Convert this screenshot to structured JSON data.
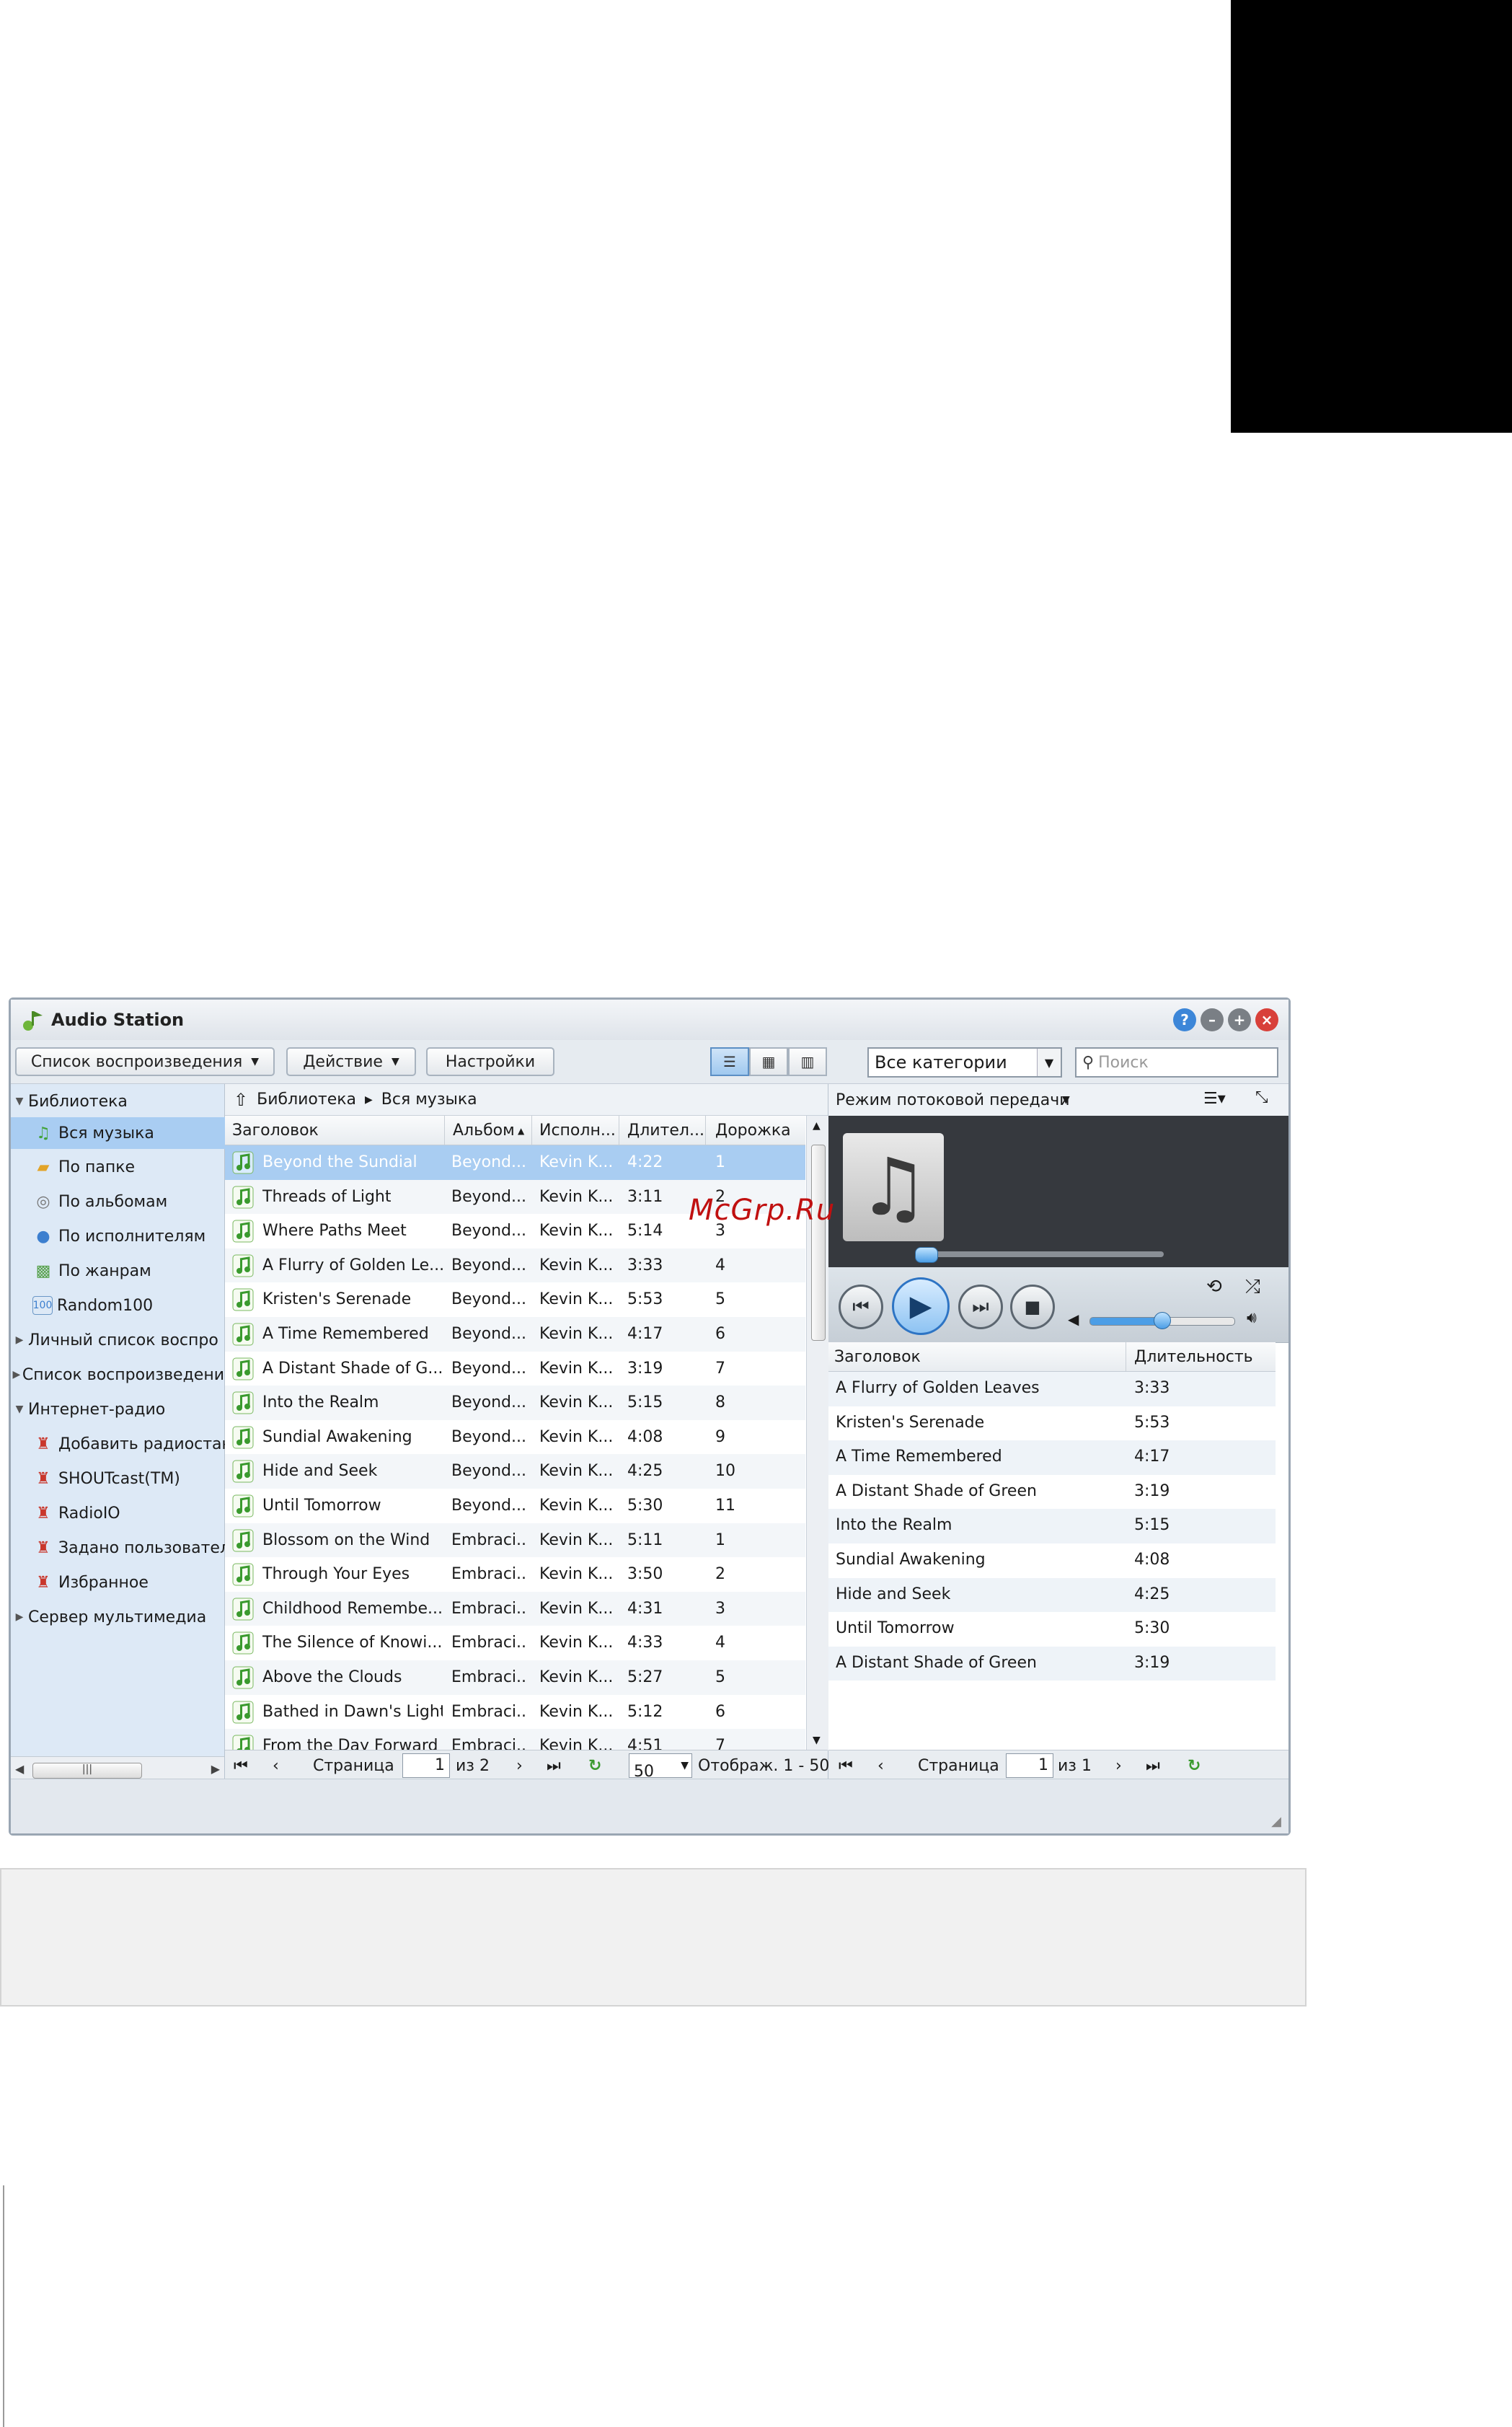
{
  "watermark": "McGrp.Ru",
  "window": {
    "title": "Audio Station"
  },
  "toolbar": {
    "playlist_label": "Список воспроизведения",
    "action_label": "Действие",
    "settings_label": "Настройки",
    "category_value": "Все категории",
    "search_placeholder": "Поиск"
  },
  "sidebar": {
    "items": [
      {
        "label": "Библиотека",
        "icon": "expanded-triangle-icon"
      },
      {
        "label": "Вся музыка",
        "icon": "music-note-icon"
      },
      {
        "label": "По папке",
        "icon": "folder-icon"
      },
      {
        "label": "По альбомам",
        "icon": "disc-icon"
      },
      {
        "label": "По исполнителям",
        "icon": "person-icon"
      },
      {
        "label": "По жанрам",
        "icon": "genre-icon"
      },
      {
        "label": "Random100",
        "icon": "random100-icon"
      },
      {
        "label": "Личный список воспро",
        "icon": "collapsed-triangle-icon"
      },
      {
        "label": "Список воспроизведени",
        "icon": "collapsed-triangle-icon"
      },
      {
        "label": "Интернет-радио",
        "icon": "expanded-triangle-icon"
      },
      {
        "label": "Добавить радиостанц",
        "icon": "radio-tower-add-icon"
      },
      {
        "label": "SHOUTcast(TM)",
        "icon": "radio-tower-icon"
      },
      {
        "label": "RadioIO",
        "icon": "radio-tower-icon"
      },
      {
        "label": "Задано пользователе",
        "icon": "radio-tower-icon"
      },
      {
        "label": "Избранное",
        "icon": "radio-tower-icon"
      },
      {
        "label": "Сервер мультимедиа",
        "icon": "collapsed-triangle-icon"
      }
    ]
  },
  "library": {
    "breadcrumb": [
      "Библиотека",
      "Вся музыка"
    ],
    "columns": [
      "Заголовок",
      "Альбом",
      "Исполн...",
      "Длител...",
      "Дорожка"
    ],
    "rows": [
      {
        "title": "Beyond the Sundial",
        "album": "Beyond...",
        "artist": "Kevin K...",
        "duration": "4:22",
        "track": "1"
      },
      {
        "title": "Threads of Light",
        "album": "Beyond...",
        "artist": "Kevin K...",
        "duration": "3:11",
        "track": "2"
      },
      {
        "title": "Where Paths Meet",
        "album": "Beyond...",
        "artist": "Kevin K...",
        "duration": "5:14",
        "track": "3"
      },
      {
        "title": "A Flurry of Golden Le...",
        "album": "Beyond...",
        "artist": "Kevin K...",
        "duration": "3:33",
        "track": "4"
      },
      {
        "title": "Kristen's Serenade",
        "album": "Beyond...",
        "artist": "Kevin K...",
        "duration": "5:53",
        "track": "5"
      },
      {
        "title": "A Time Remembered",
        "album": "Beyond...",
        "artist": "Kevin K...",
        "duration": "4:17",
        "track": "6"
      },
      {
        "title": "A Distant Shade of G...",
        "album": "Beyond...",
        "artist": "Kevin K...",
        "duration": "3:19",
        "track": "7"
      },
      {
        "title": "Into the Realm",
        "album": "Beyond...",
        "artist": "Kevin K...",
        "duration": "5:15",
        "track": "8"
      },
      {
        "title": "Sundial Awakening",
        "album": "Beyond...",
        "artist": "Kevin K...",
        "duration": "4:08",
        "track": "9"
      },
      {
        "title": "Hide and Seek",
        "album": "Beyond...",
        "artist": "Kevin K...",
        "duration": "4:25",
        "track": "10"
      },
      {
        "title": "Until Tomorrow",
        "album": "Beyond...",
        "artist": "Kevin K...",
        "duration": "5:30",
        "track": "11"
      },
      {
        "title": "Blossom on the Wind",
        "album": "Embraci...",
        "artist": "Kevin K...",
        "duration": "5:11",
        "track": "1"
      },
      {
        "title": "Through Your Eyes",
        "album": "Embraci...",
        "artist": "Kevin K...",
        "duration": "3:50",
        "track": "2"
      },
      {
        "title": "Childhood Remembe...",
        "album": "Embraci...",
        "artist": "Kevin K...",
        "duration": "4:31",
        "track": "3"
      },
      {
        "title": "The Silence of Knowi...",
        "album": "Embraci...",
        "artist": "Kevin K...",
        "duration": "4:33",
        "track": "4"
      },
      {
        "title": "Above the Clouds",
        "album": "Embraci...",
        "artist": "Kevin K...",
        "duration": "5:27",
        "track": "5"
      },
      {
        "title": "Bathed in Dawn's Light",
        "album": "Embraci...",
        "artist": "Kevin K...",
        "duration": "5:12",
        "track": "6"
      },
      {
        "title": "From the Day Forward",
        "album": "Embraci...",
        "artist": "Kevin K...",
        "duration": "4:51",
        "track": "7"
      }
    ],
    "pager": {
      "page_label": "Страница",
      "page": "1",
      "of_label": "из 2",
      "page_size": "50",
      "shown_label": "Отображ. 1 - 50"
    }
  },
  "player": {
    "mode_label": "Режим потоковой передачи",
    "progress": 0.0,
    "volume": 0.5,
    "columns": [
      "Заголовок",
      "Длительность"
    ],
    "rows": [
      {
        "title": "A Flurry of Golden Leaves",
        "duration": "3:33"
      },
      {
        "title": "Kristen's Serenade",
        "duration": "5:53"
      },
      {
        "title": "A Time Remembered",
        "duration": "4:17"
      },
      {
        "title": "A Distant Shade of Green",
        "duration": "3:19"
      },
      {
        "title": "Into the Realm",
        "duration": "5:15"
      },
      {
        "title": "Sundial Awakening",
        "duration": "4:08"
      },
      {
        "title": "Hide and Seek",
        "duration": "4:25"
      },
      {
        "title": "Until Tomorrow",
        "duration": "5:30"
      },
      {
        "title": "A Distant Shade of Green",
        "duration": "3:19"
      }
    ],
    "pager": {
      "page_label": "Страница",
      "page": "1",
      "of_label": "из 1"
    }
  },
  "colors": {
    "accent": "#a9cdf2",
    "selection": "#a9cdf2",
    "note_green": "#43a33b"
  }
}
